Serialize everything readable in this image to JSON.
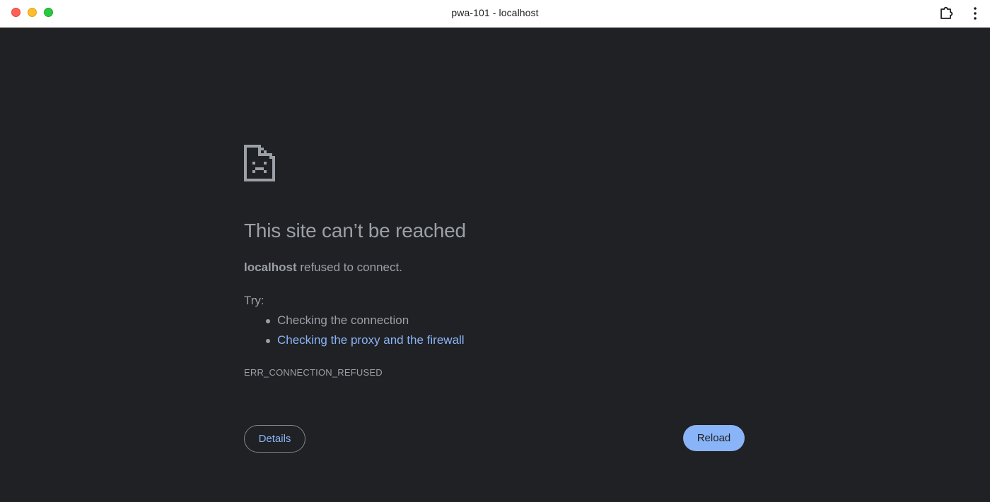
{
  "window": {
    "title": "pwa-101 - localhost"
  },
  "error": {
    "heading": "This site can’t be reached",
    "host": "localhost",
    "message": " refused to connect.",
    "try_label": "Try:",
    "suggestions": [
      {
        "text": "Checking the connection",
        "link": false
      },
      {
        "text": "Checking the proxy and the firewall",
        "link": true
      }
    ],
    "code": "ERR_CONNECTION_REFUSED"
  },
  "buttons": {
    "details_label": "Details",
    "reload_label": "Reload"
  },
  "icons": {
    "error_page": "sad-page-icon",
    "extension": "puzzle-piece-icon",
    "menu": "kebab-menu-icon"
  },
  "colors": {
    "background": "#202124",
    "text": "#9aa0a6",
    "link": "#8ab4f8",
    "primary_button": "#8ab4f8"
  }
}
